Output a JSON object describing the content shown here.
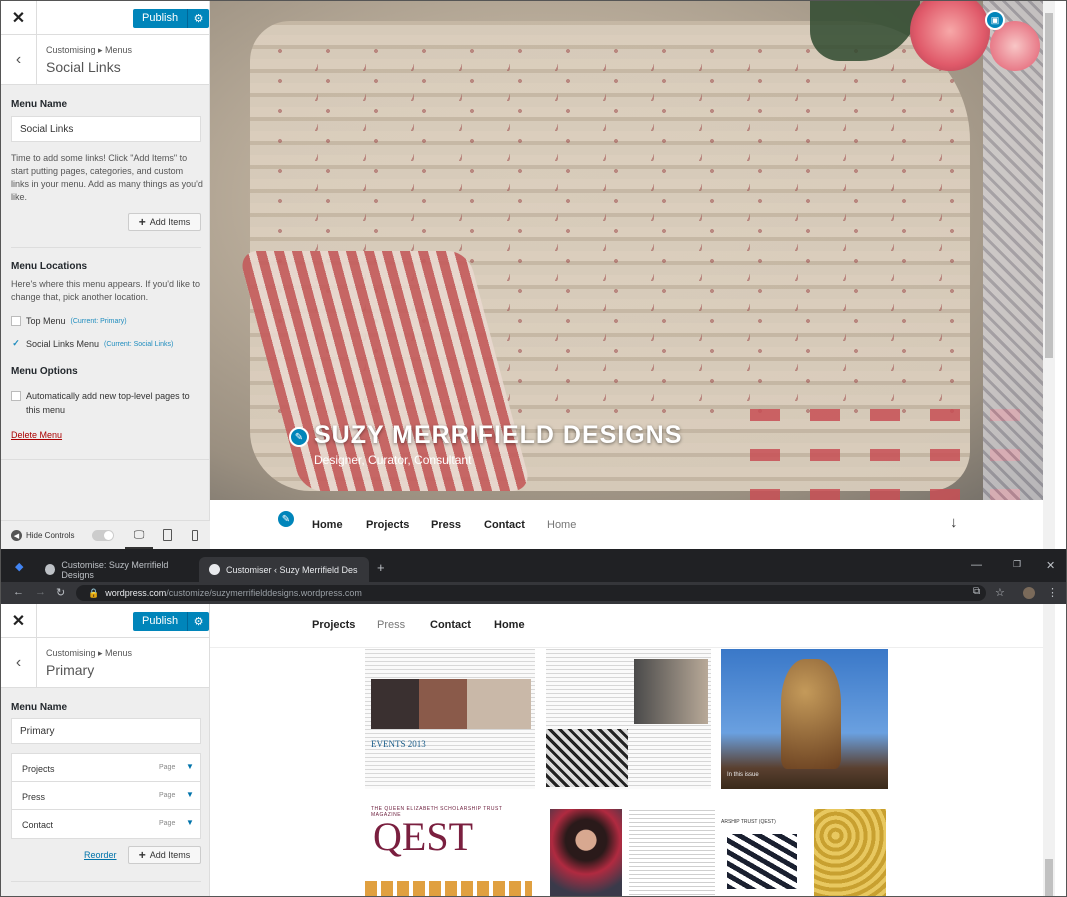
{
  "top": {
    "publish_label": "Publish",
    "breadcrumb": "Customising ▸ Menus",
    "section_title": "Social Links",
    "menu_name_label": "Menu Name",
    "menu_name_value": "Social Links",
    "help_text": "Time to add some links! Click \"Add Items\" to start putting pages, categories, and custom links in your menu. Add as many things as you'd like.",
    "add_items_label": "Add Items",
    "menu_locations_label": "Menu Locations",
    "locations_help": "Here's where this menu appears. If you'd like to change that, pick another location.",
    "locations": [
      {
        "label": "Top Menu",
        "note": "(Current: Primary)",
        "checked": false
      },
      {
        "label": "Social Links Menu",
        "note": "(Current: Social Links)",
        "checked": true
      }
    ],
    "menu_options_label": "Menu Options",
    "auto_add_label": "Automatically add new top-level pages to this menu",
    "delete_menu_label": "Delete Menu",
    "hide_controls_label": "Hide Controls",
    "site_title": "SUZY MERRIFIELD DESIGNS",
    "site_description": "Designer, Curator, Consultant",
    "nav_items": [
      "Home",
      "Projects",
      "Press",
      "Contact",
      "Home"
    ]
  },
  "browser": {
    "tabs": [
      {
        "label": "Customise: Suzy Merrifield Designs"
      },
      {
        "label": "Customiser ‹ Suzy Merrifield Des"
      }
    ],
    "url_host": "wordpress.com",
    "url_path": "/customize/suzymerrifielddesigns.wordpress.com",
    "new_tab_icon": "+"
  },
  "bottom": {
    "publish_label": "Publish",
    "breadcrumb": "Customising ▸ Menus",
    "section_title": "Primary",
    "menu_name_label": "Menu Name",
    "menu_name_value": "Primary",
    "items": [
      {
        "label": "Projects",
        "type": "Page"
      },
      {
        "label": "Press",
        "type": "Page"
      },
      {
        "label": "Contact",
        "type": "Page"
      }
    ],
    "reorder_label": "Reorder",
    "add_items_label": "Add Items",
    "nav_items": [
      "Projects",
      "Press",
      "Contact",
      "Home"
    ],
    "collage": {
      "events_heading": "EVENTS 2013",
      "qest_title": "QEST",
      "qest_banner": "THE QUEEN ELIZABETH SCHOLARSHIP TRUST MAGAZINE",
      "in_this_issue": "In this issue",
      "article_heading": "ARSHIP TRUST (QEST)"
    }
  },
  "colors": {
    "accent": "#0085ba",
    "delete": "#a00000",
    "chrome_dark": "#202124"
  }
}
